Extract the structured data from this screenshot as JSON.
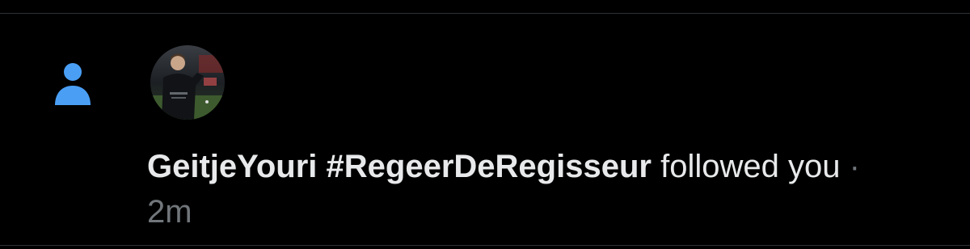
{
  "notification": {
    "type_icon": "person-icon",
    "user": {
      "display_name": "GeitjeYouri #RegeerDeRegisseur",
      "avatar_icon": "user-avatar"
    },
    "action_text": "followed you",
    "separator": "·",
    "timestamp": "2m"
  },
  "colors": {
    "background": "#000000",
    "divider": "#2f3336",
    "accent": "#1d9bf0",
    "primary_text": "#e7e9ea",
    "secondary_text": "#71767b"
  }
}
